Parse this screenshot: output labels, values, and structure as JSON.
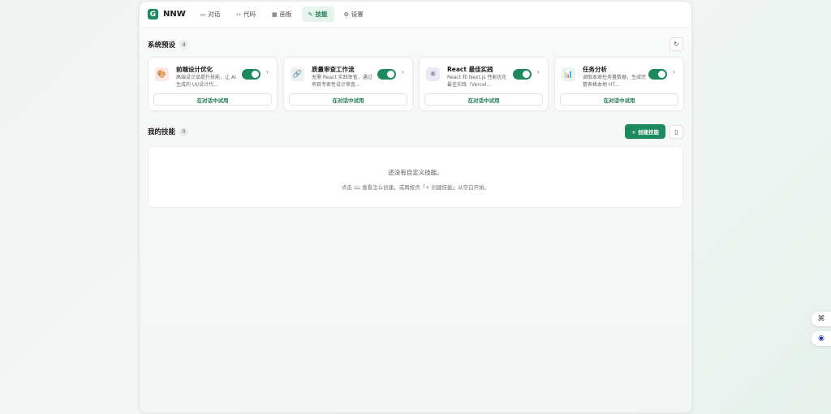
{
  "app": {
    "logo_letter": "G",
    "name": "NNW"
  },
  "nav": [
    {
      "icon": "chat-icon",
      "glyph": "▭",
      "label": "对话",
      "active": false
    },
    {
      "icon": "code-icon",
      "glyph": "‹›",
      "label": "代码",
      "active": false
    },
    {
      "icon": "board-icon",
      "glyph": "▦",
      "label": "画板",
      "active": false
    },
    {
      "icon": "skill-icon",
      "glyph": "✎",
      "label": "技能",
      "active": true
    },
    {
      "icon": "settings-icon",
      "glyph": "⚙",
      "label": "设置",
      "active": false
    }
  ],
  "system": {
    "title": "系统预设",
    "count": "4",
    "cards": [
      {
        "icon": "palette-icon",
        "glyph": "🎨",
        "icon_bg": "#fde8e6",
        "title": "前端设计优化",
        "desc": "高端设计品提升技能，让 AI 生成的 UI/设计代...",
        "try_label": "在对话中试用"
      },
      {
        "icon": "link-icon",
        "glyph": "🔗",
        "icon_bg": "#f0f0f0",
        "title": "质量审查工作流",
        "desc": "无需 React 实践审查，通过项目专家性设计审查...",
        "try_label": "在对话中试用"
      },
      {
        "icon": "react-icon",
        "glyph": "⚛",
        "icon_bg": "#ece8f7",
        "title": "React 最佳实践",
        "desc": "React 和 Next.js 性能优化最佳实践（Vercel...",
        "try_label": "在对话中试用"
      },
      {
        "icon": "chart-icon",
        "glyph": "📊",
        "icon_bg": "#e7f5ea",
        "title": "任务分析",
        "desc": "调取本周任务量数据，生成完整表格本地 HT...",
        "try_label": "在对话中试用"
      }
    ]
  },
  "mine": {
    "title": "我的技能",
    "count": "0",
    "create_label": "+ 创建技能",
    "empty_title": "还没有自定义技能。",
    "empty_hint": "点击 📖 查看怎么创建，或再按点「+ 创建技能」从空白开始。"
  },
  "colors": {
    "accent": "#1c8a5c",
    "active_tab_bg": "#e6f4ee"
  }
}
